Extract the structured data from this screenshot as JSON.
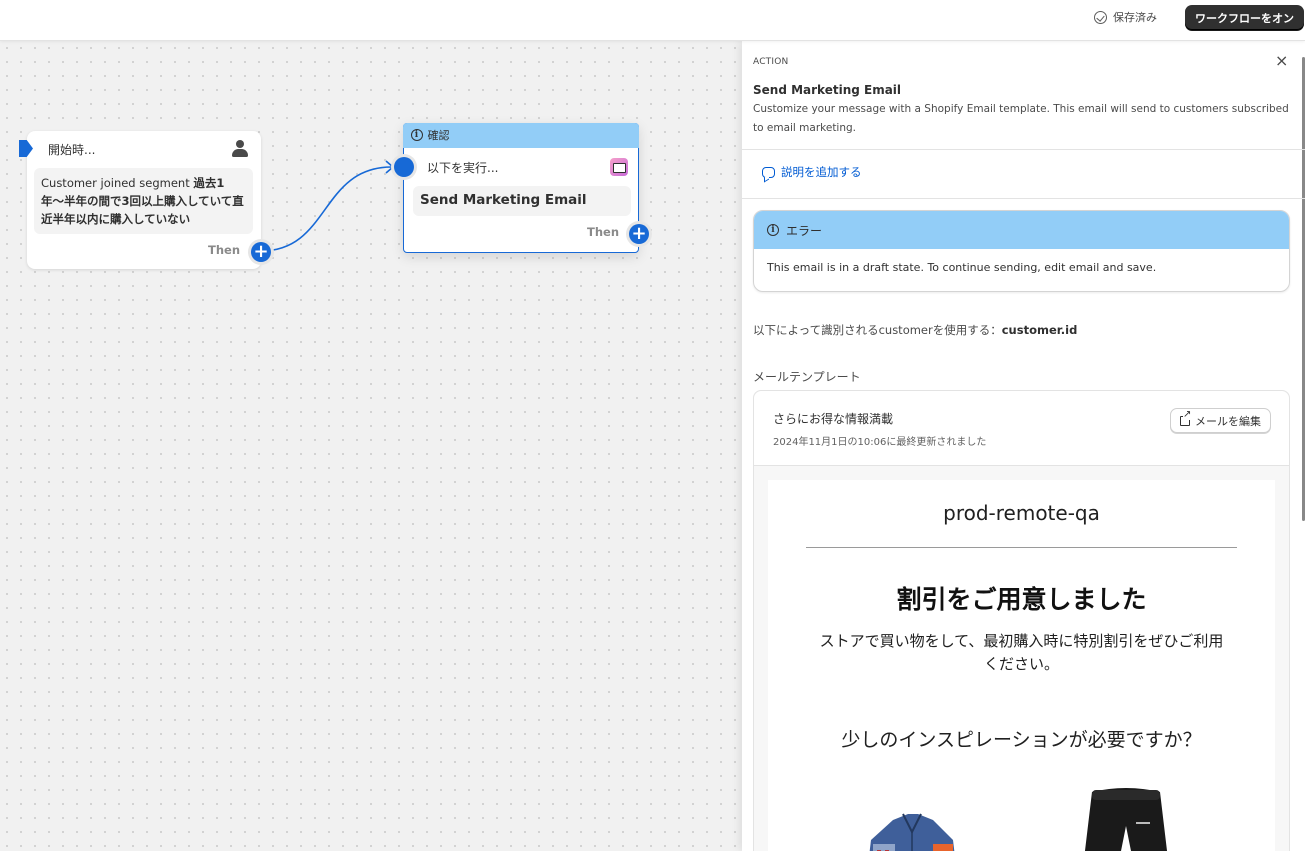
{
  "topbar": {
    "saved_label": "保存済み",
    "turn_on_label": "ワークフローをオン"
  },
  "trigger": {
    "title": "開始時...",
    "text_prefix": "Customer joined segment ",
    "text_bold": "過去1年〜半年の間で3回以上購入していて直近半年以内に購入していない",
    "then_label": "Then"
  },
  "action_node": {
    "status_label": "確認",
    "run_label": "以下を実行...",
    "title": "Send Marketing Email",
    "then_label": "Then"
  },
  "panel": {
    "label": "ACTION",
    "close": "×",
    "title": "Send Marketing Email",
    "description": "Customize your message with a Shopify Email template. This email will send to customers subscribed to email marketing.",
    "add_description": "説明を追加する",
    "error": {
      "title": "エラー",
      "message": "This email is in a draft state. To continue sending, edit email and save."
    },
    "use_customer_prefix": "以下によって識別されるcustomerを使用する：",
    "use_customer_value": "customer.id",
    "template_label": "メールテンプレート",
    "template": {
      "name": "さらにお得な情報満載",
      "updated": "2024年11月1日の10:06に最終更新されました",
      "edit_label": "メールを編集"
    },
    "preview": {
      "store": "prod-remote-qa",
      "headline": "割引をご用意しました",
      "body": "ストアで買い物をして、最初購入時に特別割引をぜひご利用ください。",
      "subheadline": "少しのインスピレーションが必要ですか？"
    }
  },
  "colors": {
    "accent": "#1769d6",
    "info_banner": "#92cdf7",
    "link": "#005bd3",
    "primary_button": "#303030"
  }
}
